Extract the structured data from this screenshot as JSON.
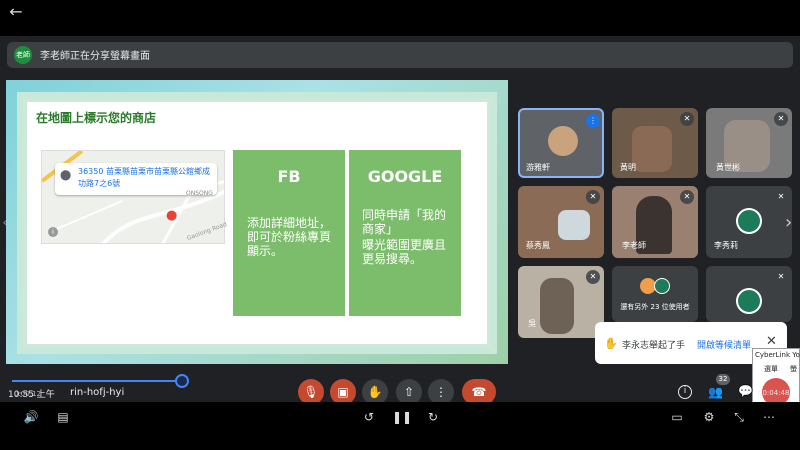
{
  "top": {
    "back": "←"
  },
  "banner": {
    "avatar": "老師",
    "text": "李老師正在分享螢幕畫面"
  },
  "slide": {
    "title": "在地圖上標示您的商店",
    "map_address": "36350 苗栗縣苗栗市苗栗縣公館鄉成功路7之6號",
    "map_sublabel": "ONSONG",
    "map_road": "Gaolong Road",
    "fb_title": "FB",
    "fb_body": "添加詳細地址，即可於粉絲專頁顯示。",
    "google_title": "GOOGLE",
    "google_body_1": "同時申請「我的商家」",
    "google_body_2": "曝光範圍更廣且更易搜尋。"
  },
  "participants": [
    {
      "name": "游雅軒"
    },
    {
      "name": "黃明"
    },
    {
      "name": "黃世彬"
    },
    {
      "name": "蔡秀鳳"
    },
    {
      "name": "李老師"
    },
    {
      "name": "李秀莉"
    },
    {
      "name": "吳"
    },
    {
      "name": "還有另外 23 位使用者"
    },
    {
      "name": ""
    }
  ],
  "raise_hand": {
    "text": "李永志舉起了手",
    "link": "開啟等候清單"
  },
  "controls": {
    "clock": "10:55 上午",
    "meeting_code": "rin-hofj-hyi",
    "elapsed": "0:00:12",
    "right_time": "00:04:48",
    "participant_count": "32"
  },
  "overlay": {
    "title": "CyberLink YouCam (10",
    "tab1": "選單",
    "tab2": "螢"
  },
  "colors": {
    "accent": "#4285f4",
    "end_call": "#c5492f",
    "slide_green": "#7cbd6b"
  }
}
